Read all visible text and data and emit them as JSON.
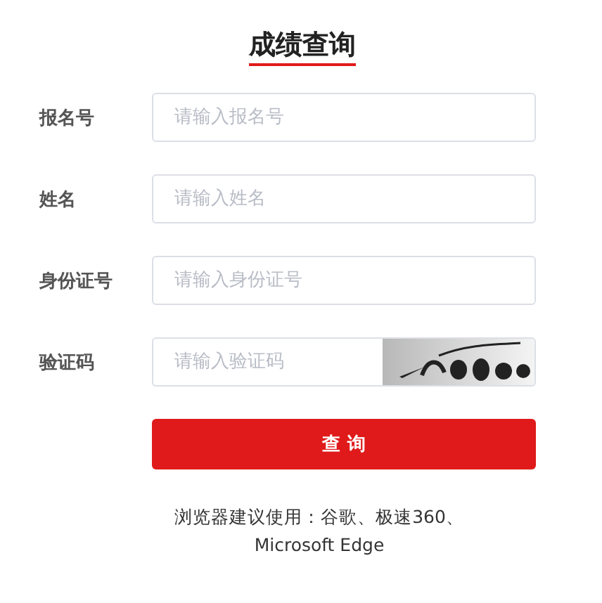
{
  "title": "成绩查询",
  "fields": [
    {
      "label": "报名号",
      "placeholder": "请输入报名号",
      "kind": "text"
    },
    {
      "label": "姓名",
      "placeholder": "请输入姓名",
      "kind": "text"
    },
    {
      "label": "身份证号",
      "placeholder": "请输入身份证号",
      "kind": "text"
    },
    {
      "label": "验证码",
      "placeholder": "请输入验证码",
      "kind": "captcha"
    }
  ],
  "submit_button": "查 询",
  "browser_note": "浏览器建议使用：谷歌、极速360、Microsoft Edge"
}
